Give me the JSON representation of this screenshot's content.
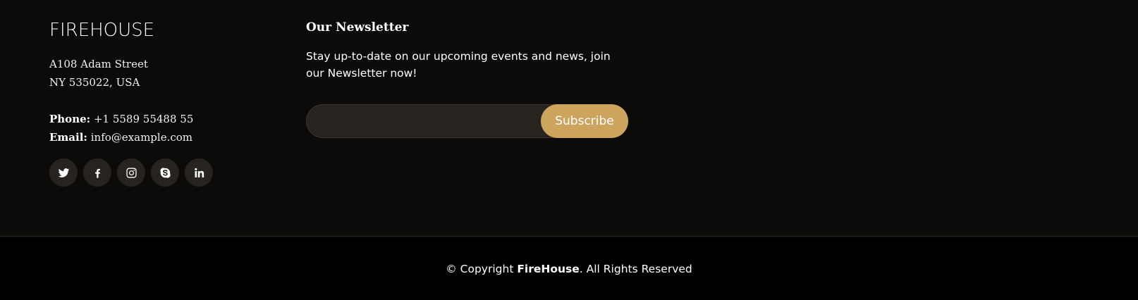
{
  "brand": {
    "logo": "FIREHOUSE",
    "address_line1": "A108 Adam Street",
    "address_line2": "NY 535022, USA",
    "phone_label": "Phone:",
    "phone_value": "+1 5589 55488 55",
    "email_label": "Email:",
    "email_value": "info@example.com"
  },
  "social": [
    {
      "icon": "twitter-icon"
    },
    {
      "icon": "facebook-icon"
    },
    {
      "icon": "instagram-icon"
    },
    {
      "icon": "skype-icon"
    },
    {
      "icon": "linkedin-icon"
    }
  ],
  "newsletter": {
    "title": "Our Newsletter",
    "text": "Stay up-to-date on our upcoming events and news, join our Newsletter now!",
    "input_value": "",
    "input_placeholder": "",
    "button_label": "Subscribe"
  },
  "footer": {
    "copyright_prefix": "© Copyright ",
    "copyright_brand": "FireHouse",
    "copyright_suffix": ". All Rights Reserved"
  },
  "colors": {
    "background": "#0c0b09",
    "bottom_bar": "#000000",
    "accent": "#cda45e",
    "social_bg": "#27241f"
  }
}
